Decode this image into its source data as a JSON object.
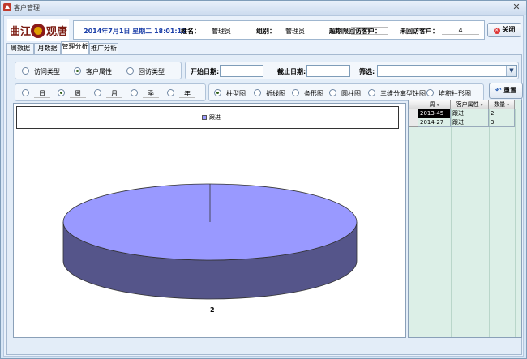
{
  "window": {
    "title": "客户管理",
    "close_glyph": "✕"
  },
  "logo": {
    "text_left": "曲江",
    "text_right": "观唐",
    "colors": [
      "#c81e1e",
      "#e0a000"
    ]
  },
  "info": {
    "date": "2014年7月1日 星期二 18:01:13",
    "name_label": "姓名：",
    "name_value": "管理员",
    "group_label": "组别：",
    "group_value": "管理员",
    "overdue_label": "超期限回访客户：",
    "overdue_value": "0",
    "unvisited_label": "未回访客户：",
    "unvisited_value": "4"
  },
  "buttons": {
    "close": "关闭",
    "reset": "重置"
  },
  "tabs": [
    {
      "label": "周数据"
    },
    {
      "label": "月数据"
    },
    {
      "label": "管理分析"
    },
    {
      "label": "推广分析"
    }
  ],
  "filters": {
    "type_options": [
      {
        "label": "访问类型",
        "selected": false
      },
      {
        "label": "客户属性",
        "selected": true
      },
      {
        "label": "回访类型",
        "selected": false
      }
    ],
    "start_date_label": "开始日期:",
    "end_date_label": "截止日期:",
    "filter_label": "筛选:",
    "start_date_value": "",
    "end_date_value": "",
    "filter_value": "",
    "period_options": [
      {
        "label": "日",
        "selected": false
      },
      {
        "label": "周",
        "selected": true
      },
      {
        "label": "月",
        "selected": false
      },
      {
        "label": "季",
        "selected": false
      },
      {
        "label": "年",
        "selected": false
      }
    ],
    "chart_options": [
      {
        "label": "柱型图",
        "selected": true
      },
      {
        "label": "折线图",
        "selected": false
      },
      {
        "label": "条形图",
        "selected": false
      },
      {
        "label": "圆柱图",
        "selected": false
      },
      {
        "label": "三维分离型饼图",
        "selected": false
      },
      {
        "label": "堆积柱形图",
        "selected": false
      }
    ]
  },
  "chart_data": {
    "type": "pie",
    "categories": [
      "跟进"
    ],
    "values": [
      2
    ],
    "legend": [
      "跟进"
    ],
    "value_labels": [
      "2"
    ],
    "colors": {
      "top": "#9999ff",
      "side": "#55558a"
    },
    "legend_placement": "top"
  },
  "table": {
    "columns": [
      "周",
      "客户属性",
      "数量"
    ],
    "rows": [
      {
        "week": "2013-45",
        "attribute": "跟进",
        "count": "2"
      },
      {
        "week": "2014-27",
        "attribute": "跟进",
        "count": "3"
      }
    ]
  },
  "colors": {
    "accent": "#1c3fa8",
    "grid_bg": "#dcefe7"
  }
}
